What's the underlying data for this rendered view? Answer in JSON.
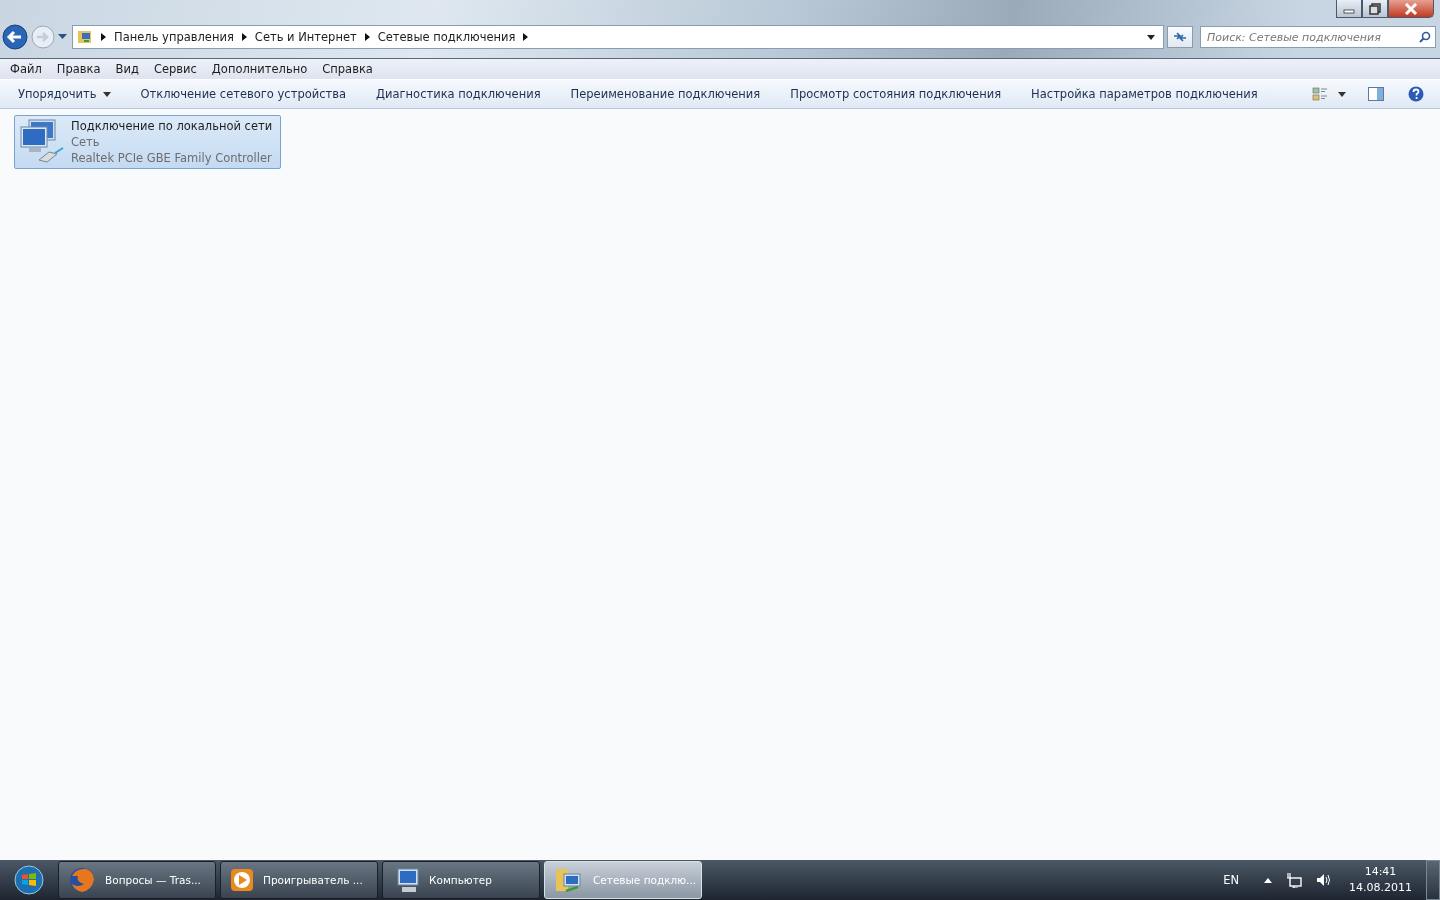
{
  "breadcrumb": [
    "Панель управления",
    "Сеть и Интернет",
    "Сетевые подключения"
  ],
  "search": {
    "placeholder": "Поиск: Сетевые подключения"
  },
  "menu": [
    "Файл",
    "Правка",
    "Вид",
    "Сервис",
    "Дополнительно",
    "Справка"
  ],
  "toolbar": {
    "organize": "Упорядочить",
    "commands": [
      "Отключение сетевого устройства",
      "Диагностика подключения",
      "Переименование подключения",
      "Просмотр состояния подключения",
      "Настройка параметров подключения"
    ]
  },
  "connections": [
    {
      "name": "Подключение по локальной сети",
      "network": "Сеть",
      "adapter": "Realtek PCIe GBE Family Controller",
      "selected": true
    }
  ],
  "taskbar": {
    "items": [
      {
        "kind": "browser",
        "label": "Вопросы — Tras...",
        "selected": false
      },
      {
        "kind": "player",
        "label": "Проигрыватель ...",
        "selected": false
      },
      {
        "kind": "computer",
        "label": "Компьютер",
        "selected": false
      },
      {
        "kind": "network",
        "label": "Сетевые подклю...",
        "selected": true
      }
    ],
    "language": "EN",
    "time": "14:41",
    "date": "14.08.2011"
  }
}
